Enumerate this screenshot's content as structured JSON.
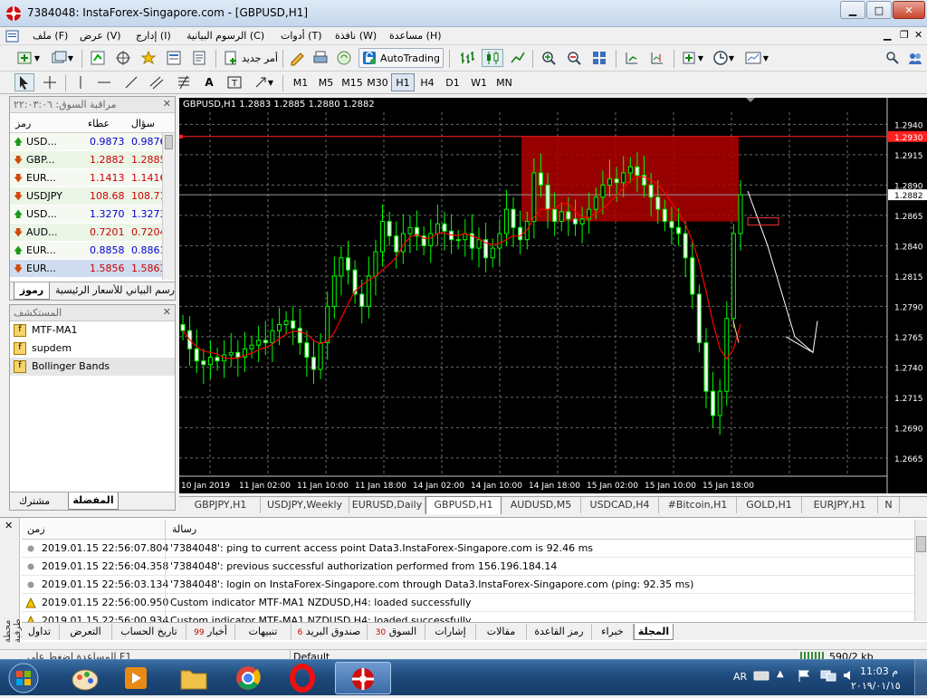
{
  "window": {
    "title": "7384048: InstaForex-Singapore.com - [GBPUSD,H1]"
  },
  "menu": [
    "ملف (F)",
    "عرض (V)",
    "إدارج (I)",
    "الرسوم البيانية (C)",
    "أدوات (T)",
    "نافذة (W)",
    "مساعدة (H)"
  ],
  "toolbar": {
    "new_order": "أمر جديد",
    "autotrading": "AutoTrading"
  },
  "timeframes": [
    "M1",
    "M5",
    "M15",
    "M30",
    "H1",
    "H4",
    "D1",
    "W1",
    "MN"
  ],
  "active_timeframe": "H1",
  "market_watch": {
    "title": "مراقبة السوق: ٢٢:٠٣:٠٦",
    "col_symbol": "رمز",
    "col_bid": "عطاء",
    "col_ask": "سؤال",
    "rows": [
      {
        "symbol": "USD...",
        "bid": "0.9873",
        "ask": "0.9876",
        "dir": "up",
        "color": "#0000cc"
      },
      {
        "symbol": "GBP...",
        "bid": "1.2882",
        "ask": "1.2885",
        "dir": "down",
        "color": "#cc0000"
      },
      {
        "symbol": "EUR...",
        "bid": "1.1413",
        "ask": "1.1416",
        "dir": "down",
        "color": "#cc0000"
      },
      {
        "symbol": "USDJPY",
        "bid": "108.68",
        "ask": "108.71",
        "dir": "down",
        "color": "#cc0000"
      },
      {
        "symbol": "USD...",
        "bid": "1.3270",
        "ask": "1.3273",
        "dir": "up",
        "color": "#0000cc"
      },
      {
        "symbol": "AUD...",
        "bid": "0.7201",
        "ask": "0.7204",
        "dir": "down",
        "color": "#cc0000"
      },
      {
        "symbol": "EUR...",
        "bid": "0.8858",
        "ask": "0.8861",
        "dir": "up",
        "color": "#0000cc"
      },
      {
        "symbol": "EUR...",
        "bid": "1.5856",
        "ask": "1.5863",
        "dir": "down",
        "color": "#cc0000"
      }
    ],
    "tabs": [
      "رموز",
      "رسم البياني للأسعار الرئيسية"
    ]
  },
  "navigator": {
    "title": "المستكشف",
    "items": [
      "MTF-MA1",
      "supdem",
      "Bollinger Bands"
    ],
    "tabs": [
      "المفضلة",
      "مشترك"
    ]
  },
  "chart": {
    "header": "GBPUSD,H1  1.2883 1.2885 1.2880 1.2882",
    "price_labels": [
      "1.2940",
      "1.2915",
      "1.2890",
      "1.2865",
      "1.2840",
      "1.2815",
      "1.2790",
      "1.2765",
      "1.2740",
      "1.2715",
      "1.2690",
      "1.2665"
    ],
    "current_price": "1.2882",
    "line_price": "1.2930",
    "time_labels": [
      "10 Jan 2019",
      "11 Jan 02:00",
      "11 Jan 10:00",
      "11 Jan 18:00",
      "14 Jan 02:00",
      "14 Jan 10:00",
      "14 Jan 18:00",
      "15 Jan 02:00",
      "15 Jan 10:00",
      "15 Jan 18:00"
    ]
  },
  "chart_tabs": [
    "GBPJPY,H1",
    "USDJPY,Weekly",
    "EURUSD,Daily",
    "GBPUSD,H1",
    "AUDUSD,M5",
    "USDCAD,H4",
    "#Bitcoin,H1",
    "GOLD,H1",
    "EURJPY,H1",
    "N"
  ],
  "active_chart_tab": "GBPUSD,H1",
  "terminal": {
    "col_time": "زمن",
    "col_message": "رسالة",
    "side_label": "محطة طرفية",
    "rows": [
      {
        "time": "2019.01.15 22:56:07.804",
        "message": "'7384048': ping to current access point Data3.InstaForex-Singapore.com is 92.46 ms",
        "icon": "info"
      },
      {
        "time": "2019.01.15 22:56:04.358",
        "message": "'7384048': previous successful authorization performed from 156.196.184.14",
        "icon": "info"
      },
      {
        "time": "2019.01.15 22:56:03.134",
        "message": "'7384048': login on InstaForex-Singapore.com through Data3.InstaForex-Singapore.com (ping: 92.35 ms)",
        "icon": "info"
      },
      {
        "time": "2019.01.15 22:56:00.950",
        "message": "Custom indicator MTF-MA1 NZDUSD,H4: loaded successfully",
        "icon": "warn"
      },
      {
        "time": "2019.01.15 22:56:00.934",
        "message": "Custom indicator MTF-MA1 NZDUSD,H4: loaded successfully",
        "icon": "warn"
      }
    ],
    "tabs": [
      {
        "label": "المجلة",
        "badge": ""
      },
      {
        "label": "خبراء",
        "badge": ""
      },
      {
        "label": "رمز القاعدة",
        "badge": ""
      },
      {
        "label": "مقالات",
        "badge": ""
      },
      {
        "label": "إشارات",
        "badge": ""
      },
      {
        "label": "السوق",
        "badge": "30"
      },
      {
        "label": "صندوق البريد",
        "badge": "6"
      },
      {
        "label": "تنبيهات",
        "badge": ""
      },
      {
        "label": "أخبار",
        "badge": "99"
      },
      {
        "label": "تاريخ الحساب",
        "badge": ""
      },
      {
        "label": "التعرض",
        "badge": ""
      },
      {
        "label": "تداول",
        "badge": ""
      }
    ]
  },
  "status": {
    "help": "المساعدة اضغط على F1",
    "profile": "Default",
    "traffic": "590/2 kb"
  },
  "taskbar": {
    "lang": "AR",
    "time": "11:03 م",
    "date": "٢٠١٩/٠١/١٥"
  },
  "colors": {
    "chart_bg": "#000000",
    "bull": "#00ff00",
    "bear": "#00ff00",
    "zone": "#b00000",
    "ma": "#ff0000"
  }
}
